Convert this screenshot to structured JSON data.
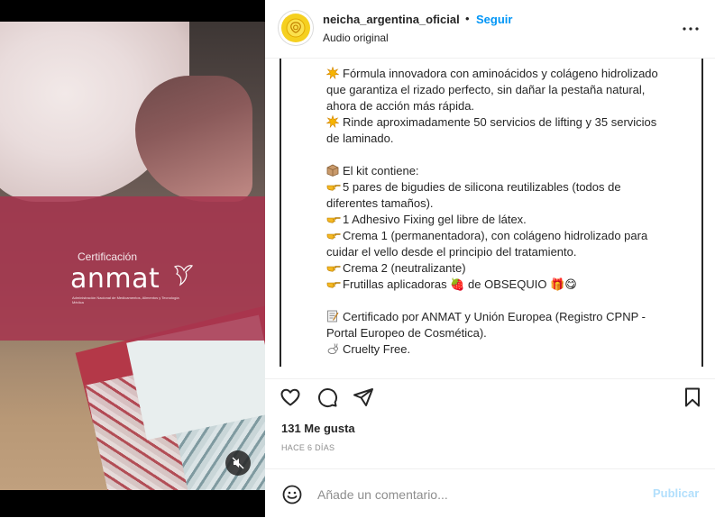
{
  "post": {
    "username": "neicha_argentina_oficial",
    "separator": "•",
    "follow_label": "Seguir",
    "audio_label": "Audio original"
  },
  "media": {
    "certification_label": "Certificación",
    "logo_text": "anmat",
    "logo_subtitle": "Administración Nacional de Medicamentos, Alimentos y Tecnología Médica"
  },
  "caption": {
    "lines": [
      {
        "icon": "sparkle",
        "text": "Fórmula innovadora con aminoácidos y colágeno hidrolizado"
      },
      {
        "icon": "",
        "text": "que garantiza el rizado perfecto, sin dañar la pestaña natural,"
      },
      {
        "icon": "",
        "text": "ahora de acción más rápida."
      },
      {
        "icon": "sparkle",
        "text": "Rinde aproximadamente 50 servicios de lifting y 35 servicios"
      },
      {
        "icon": "",
        "text": "de laminado."
      },
      {
        "icon": "",
        "text": ""
      },
      {
        "icon": "box",
        "text": "El kit contiene:"
      },
      {
        "icon": "point",
        "text": "5 pares de bigudies de silicona reutilizables (todos de"
      },
      {
        "icon": "",
        "text": "diferentes tamaños)."
      },
      {
        "icon": "point",
        "text": "1 Adhesivo Fixing gel libre de látex."
      },
      {
        "icon": "point",
        "text": "Crema 1 (permanentadora), con colágeno hidrolizado para"
      },
      {
        "icon": "",
        "text": "cuidar el vello desde el principio del tratamiento."
      },
      {
        "icon": "point",
        "text": "Crema 2 (neutralizante)"
      },
      {
        "icon": "point",
        "text": "Frutillas aplicadoras 🍓 de OBSEQUIO 🎁😋"
      },
      {
        "icon": "",
        "text": ""
      },
      {
        "icon": "memo",
        "text": "Certificado por ANMAT y Unión Europea (Registro CPNP -"
      },
      {
        "icon": "",
        "text": "Portal Europeo de Cosmética)."
      },
      {
        "icon": "rabbit",
        "text": "Cruelty Free."
      }
    ]
  },
  "actions": {
    "likes": "131 Me gusta",
    "time": "HACE 6 DÍAS"
  },
  "comment": {
    "placeholder": "Añade un comentario...",
    "publish_label": "Publicar"
  },
  "colors": {
    "accent": "#0095f6",
    "publish_disabled": "#b2dffc",
    "banner": "#a7344e"
  }
}
